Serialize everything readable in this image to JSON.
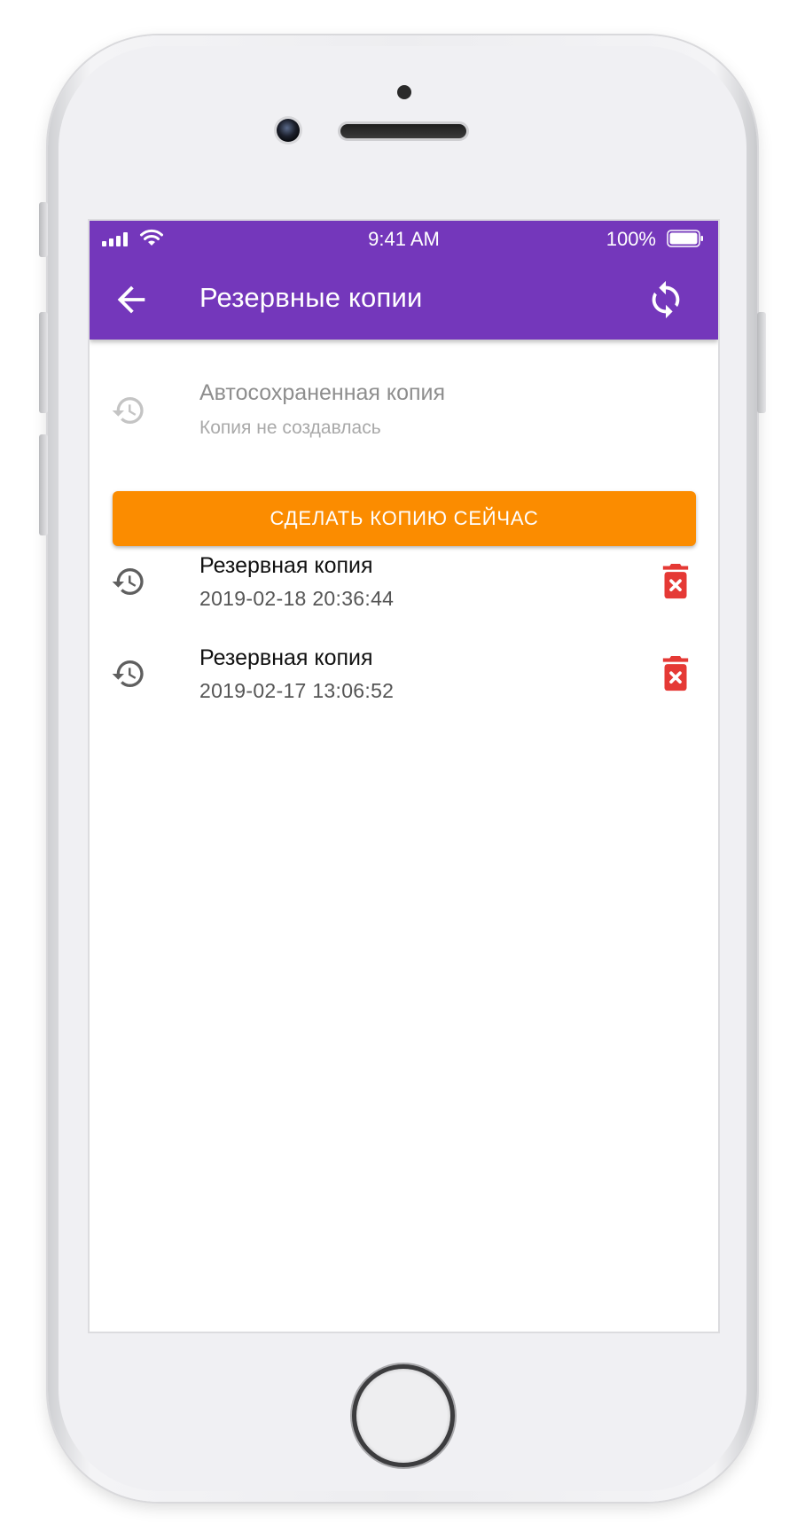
{
  "status_bar": {
    "time": "9:41 AM",
    "battery_percent": "100%"
  },
  "appbar": {
    "title": "Резервные копии",
    "back_icon": "arrow-left-icon",
    "sync_icon": "sync-icon"
  },
  "auto_backup": {
    "title": "Автосохраненная копия",
    "subtitle": "Копия не создавлась",
    "icon": "history-icon"
  },
  "primary_button": {
    "label": "СДЕЛАТЬ КОПИЮ СЕЙЧАС",
    "color": "#fb8c00"
  },
  "backups": [
    {
      "title": "Резервная копия",
      "date": "2019-02-18 20:36:44"
    },
    {
      "title": "Резервная копия",
      "date": "2019-02-17 13:06:52"
    }
  ],
  "colors": {
    "appbar": "#7437bb",
    "delete": "#e53935"
  }
}
